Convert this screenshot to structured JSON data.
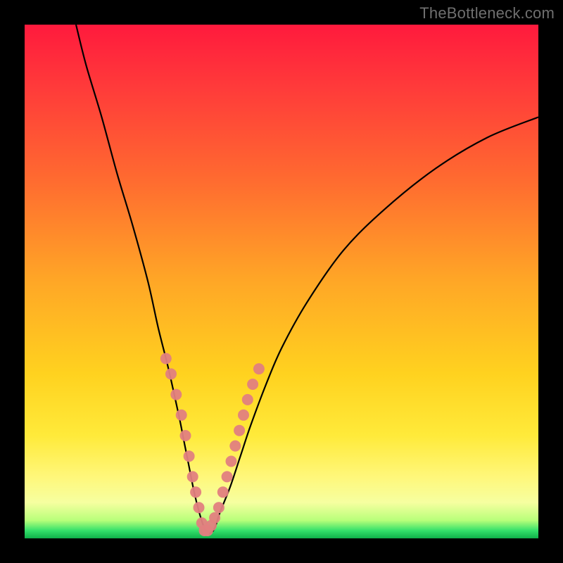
{
  "watermark": "TheBottleneck.com",
  "colors": {
    "frame": "#000000",
    "curve_stroke": "#000000",
    "marker_fill": "#e28080",
    "gradient_top": "#ff1a3d",
    "gradient_bottom": "#0fb04a"
  },
  "chart_data": {
    "type": "line",
    "title": "",
    "xlabel": "",
    "ylabel": "",
    "xlim": [
      0,
      100
    ],
    "ylim": [
      0,
      100
    ],
    "grid": false,
    "series": [
      {
        "name": "bottleneck-curve",
        "x": [
          10,
          12,
          15,
          18,
          21,
          24,
          26,
          28,
          30,
          31,
          32,
          33,
          34,
          35,
          36,
          37,
          38,
          40,
          42,
          44,
          47,
          50,
          55,
          62,
          70,
          80,
          90,
          100
        ],
        "y": [
          100,
          92,
          82,
          71,
          61,
          50,
          41,
          33,
          24,
          19,
          14,
          9,
          5,
          2,
          1,
          2,
          5,
          10,
          16,
          22,
          30,
          37,
          46,
          56,
          64,
          72,
          78,
          82
        ]
      }
    ],
    "markers": {
      "name": "highlighted-points",
      "x": [
        27.5,
        28.5,
        29.5,
        30.5,
        31.3,
        32.0,
        32.7,
        33.3,
        33.9,
        34.5,
        35.0,
        35.6,
        36.3,
        37.0,
        37.8,
        38.6,
        39.4,
        40.2,
        41.0,
        41.8,
        42.6,
        43.4,
        44.4,
        45.6
      ],
      "y": [
        35,
        32,
        28,
        24,
        20,
        16,
        12,
        9,
        6,
        3,
        1.5,
        1.5,
        2.5,
        4,
        6,
        9,
        12,
        15,
        18,
        21,
        24,
        27,
        30,
        33
      ]
    }
  }
}
